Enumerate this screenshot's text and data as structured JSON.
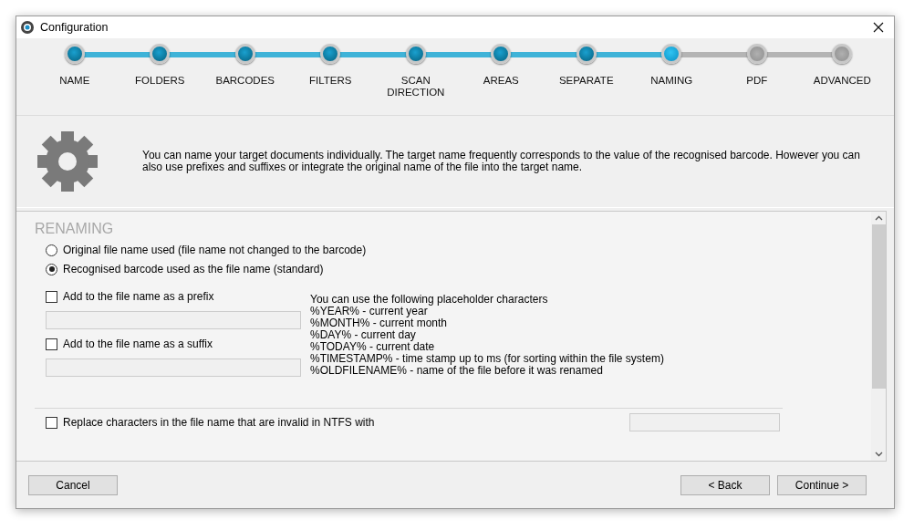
{
  "window": {
    "title": "Configuration"
  },
  "steps": [
    {
      "label": "NAME",
      "completed": true,
      "selected": false
    },
    {
      "label": "FOLDERS",
      "completed": true,
      "selected": false
    },
    {
      "label": "BARCODES",
      "completed": true,
      "selected": false
    },
    {
      "label": "FILTERS",
      "completed": true,
      "selected": false
    },
    {
      "label": "SCAN DIRECTION",
      "completed": true,
      "selected": false
    },
    {
      "label": "AREAS",
      "completed": true,
      "selected": false
    },
    {
      "label": "SEPARATE",
      "completed": true,
      "selected": false
    },
    {
      "label": "NAMING",
      "completed": false,
      "selected": true
    },
    {
      "label": "PDF",
      "completed": false,
      "selected": false
    },
    {
      "label": "ADVANCED",
      "completed": false,
      "selected": false
    }
  ],
  "description": "You can name your target documents individually. The target name frequently corresponds to the value of the recognised barcode. However you can also use prefixes and suffixes or integrate the original name of the file into the target name.",
  "renaming": {
    "heading": "RENAMING",
    "options": [
      {
        "label": "Original file name used (file name not changed to the barcode)",
        "selected": false
      },
      {
        "label": "Recognised barcode used as the file name (standard)",
        "selected": true
      }
    ],
    "prefix": {
      "label": "Add to the file name as a prefix",
      "checked": false
    },
    "suffix": {
      "label": "Add to the file name as a suffix",
      "checked": false
    },
    "placeholder_help": [
      "You can use the following placeholder characters",
      "%YEAR% - current year",
      "%MONTH% - current month",
      "%DAY% - current day",
      "%TODAY% - current date",
      "%TIMESTAMP% - time stamp up to ms (for sorting within the file system)",
      "%OLDFILENAME% - name of the file before it was renamed"
    ],
    "replace": {
      "label": "Replace characters in the file name that are invalid in NTFS with",
      "checked": false
    }
  },
  "buttons": {
    "cancel": "Cancel",
    "back": "< Back",
    "continue": "Continue >"
  }
}
